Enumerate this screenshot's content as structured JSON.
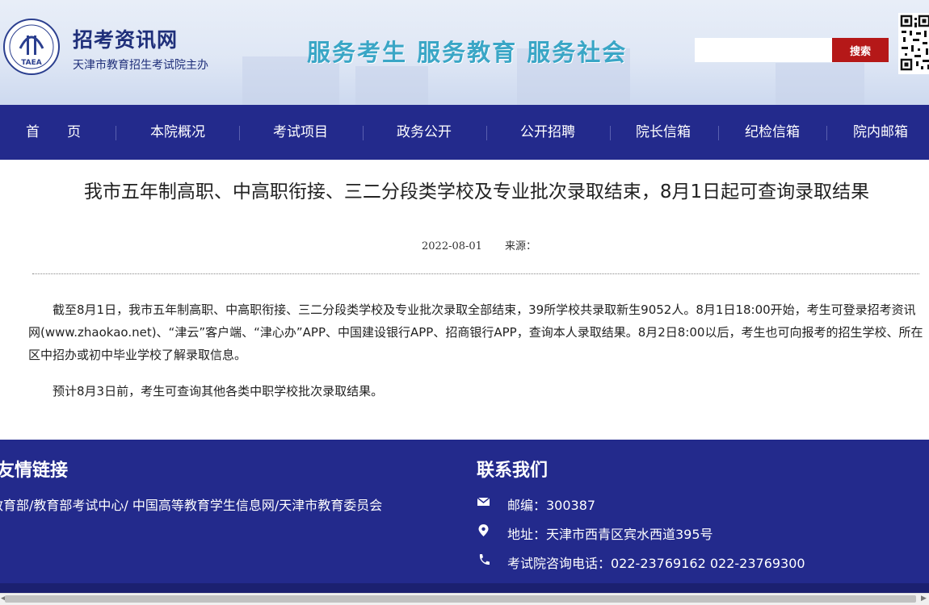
{
  "header": {
    "logo_text": "TAEA",
    "site_name": "招考资讯网",
    "site_sub": "天津市教育招生考试院主办",
    "slogan": "服务考生  服务教育  服务社会",
    "search": {
      "placeholder": "",
      "button": "搜索"
    }
  },
  "nav": {
    "items": [
      "首　　页",
      "本院概况",
      "考试项目",
      "政务公开",
      "公开招聘",
      "院长信箱",
      "纪检信箱",
      "院内邮箱"
    ]
  },
  "article": {
    "title": "我市五年制高职、中高职衔接、三二分段类学校及专业批次录取结束，8月1日起可查询录取结果",
    "date": "2022-08-01",
    "source_label": "来源：",
    "paragraphs": [
      "截至8月1日，我市五年制高职、中高职衔接、三二分段类学校及专业批次录取全部结束，39所学校共录取新生9052人。8月1日18:00开始，考生可登录招考资讯网(www.zhaokao.net)、“津云”客户端、“津心办”APP、中国建设银行APP、招商银行APP，查询本人录取结果。8月2日8:00以后，考生也可向报考的招生学校、所在区中招办或初中毕业学校了解录取信息。",
      "预计8月3日前，考生可查询其他各类中职学校批次录取结果。"
    ]
  },
  "footer": {
    "links_title": "友情链接",
    "links": "教育部/教育部考试中心/ 中国高等教育学生信息网/天津市教育委员会",
    "contact_title": "联系我们",
    "contacts": [
      {
        "icon": "mail-icon",
        "text": "邮编：300387"
      },
      {
        "icon": "location-pin-icon",
        "text": "地址：天津市西青区宾水西道395号"
      },
      {
        "icon": "phone-icon",
        "text": "考试院咨询电话：022-23769162 022-23769300"
      }
    ]
  },
  "colors": {
    "brand_navy": "#232a8c",
    "slogan_teal": "#3aa6c6",
    "search_red": "#b51818"
  }
}
